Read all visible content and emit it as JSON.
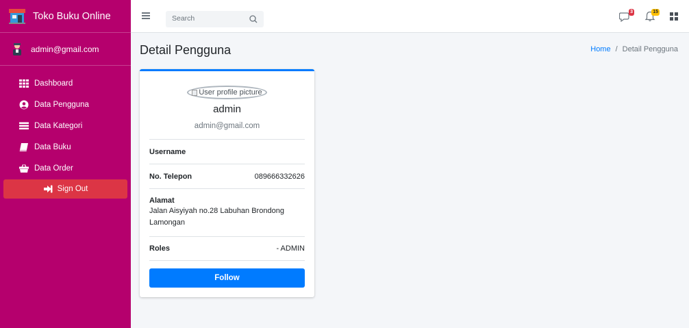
{
  "brand": {
    "name": "Toko Buku Online"
  },
  "user_panel": {
    "name": "admin@gmail.com"
  },
  "sidebar": {
    "items": [
      {
        "label": "Dashboard",
        "icon": "th-icon"
      },
      {
        "label": "Data Pengguna",
        "icon": "user-circle-icon"
      },
      {
        "label": "Data Kategori",
        "icon": "list-icon"
      },
      {
        "label": "Data Buku",
        "icon": "book-icon"
      },
      {
        "label": "Data Order",
        "icon": "basket-icon"
      }
    ],
    "signout_label": "Sign Out"
  },
  "navbar": {
    "search_placeholder": "Search",
    "messages_badge": "3",
    "notifications_badge": "15"
  },
  "page": {
    "title": "Detail Pengguna",
    "breadcrumb": {
      "home": "Home",
      "separator": "/",
      "current": "Detail Pengguna"
    }
  },
  "profile": {
    "image_alt": "User profile picture",
    "name": "admin",
    "email": "admin@gmail.com",
    "username_label": "Username",
    "username_value": "",
    "phone_label": "No. Telepon",
    "phone_value": "089666332626",
    "address_label": "Alamat",
    "address_value": "Jalan Aisyiyah no.28 Labuhan Brondong Lamongan",
    "roles_label": "Roles",
    "roles_value": "- ADMIN",
    "follow_label": "Follow"
  },
  "colors": {
    "sidebar_bg": "#b5006d",
    "signout_bg": "#dc3545",
    "primary": "#007bff"
  }
}
